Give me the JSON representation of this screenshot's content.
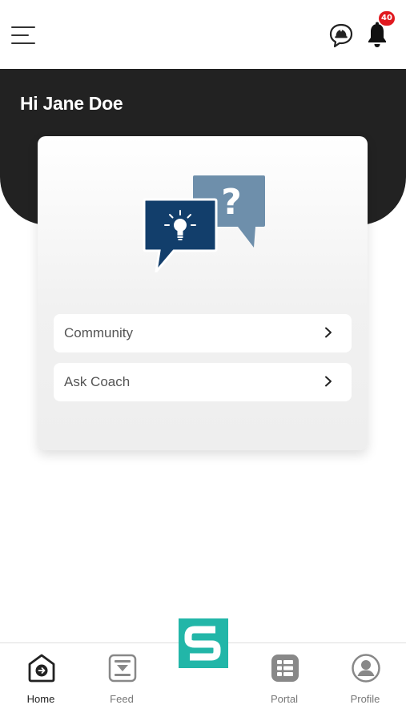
{
  "header": {
    "menu_icon": "hamburger-menu-icon",
    "chat_icon": "chat-bubble-helmet-icon",
    "notification_icon": "bell-icon",
    "notification_count": "40"
  },
  "hero": {
    "greeting": "Hi Jane Doe"
  },
  "card": {
    "illustration": "idea-question-speech-bubbles",
    "options": [
      {
        "label": "Community",
        "icon": "chevron-right-icon"
      },
      {
        "label": "Ask Coach",
        "icon": "chevron-right-icon"
      }
    ]
  },
  "bottom_nav": {
    "items": [
      {
        "label": "Home",
        "icon": "home-icon",
        "active": true
      },
      {
        "label": "Feed",
        "icon": "feed-icon",
        "active": false
      },
      {
        "label": "Portal",
        "icon": "portal-grid-icon",
        "active": false
      },
      {
        "label": "Profile",
        "icon": "profile-icon",
        "active": false
      }
    ],
    "center_logo": "s-logo-icon"
  },
  "colors": {
    "hero_background": "#222222",
    "badge": "#e0191f",
    "logo": "#22b6a8",
    "illustration_dark": "#123e6b",
    "illustration_light": "#6e8fab"
  }
}
